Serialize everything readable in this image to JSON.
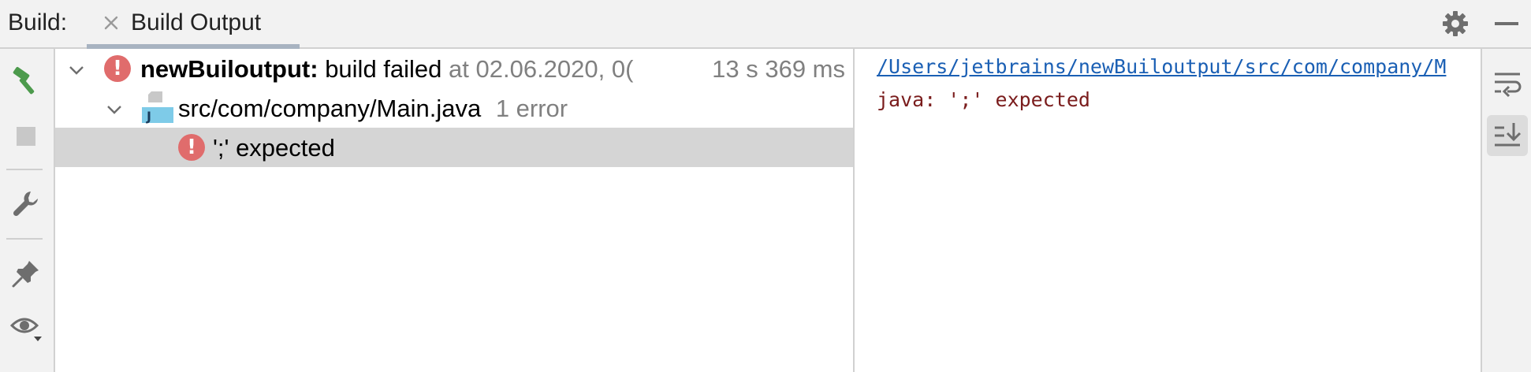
{
  "header": {
    "panel_label": "Build:",
    "tab_label": "Build Output"
  },
  "icons": {
    "build": "hammer-icon",
    "stop": "stop-icon",
    "settings": "wrench-icon",
    "pin": "pin-icon",
    "view": "eye-icon",
    "close": "close-icon",
    "gear": "gear-icon",
    "minimize": "minimize-icon",
    "soft_wrap": "soft-wrap-icon",
    "scroll_to_end": "scroll-to-end-icon"
  },
  "colors": {
    "error": "#e06c6c",
    "build_icon": "#4c9a4c",
    "link": "#1a5fb4",
    "console_error_text": "#7a1c1c",
    "selection": "#d5d5d5"
  },
  "tree": {
    "root": {
      "project": "newBuiloutput:",
      "status": "build failed",
      "timestamp": "at 02.06.2020, 0(",
      "duration": "13 s 369 ms"
    },
    "file": {
      "path": "src/com/company/Main.java",
      "errors": "1 error"
    },
    "error_item": {
      "message": "';' expected"
    }
  },
  "console": {
    "link": "/Users/jetbrains/newBuiloutput/src/com/company/M",
    "message": "java: ';' expected"
  }
}
